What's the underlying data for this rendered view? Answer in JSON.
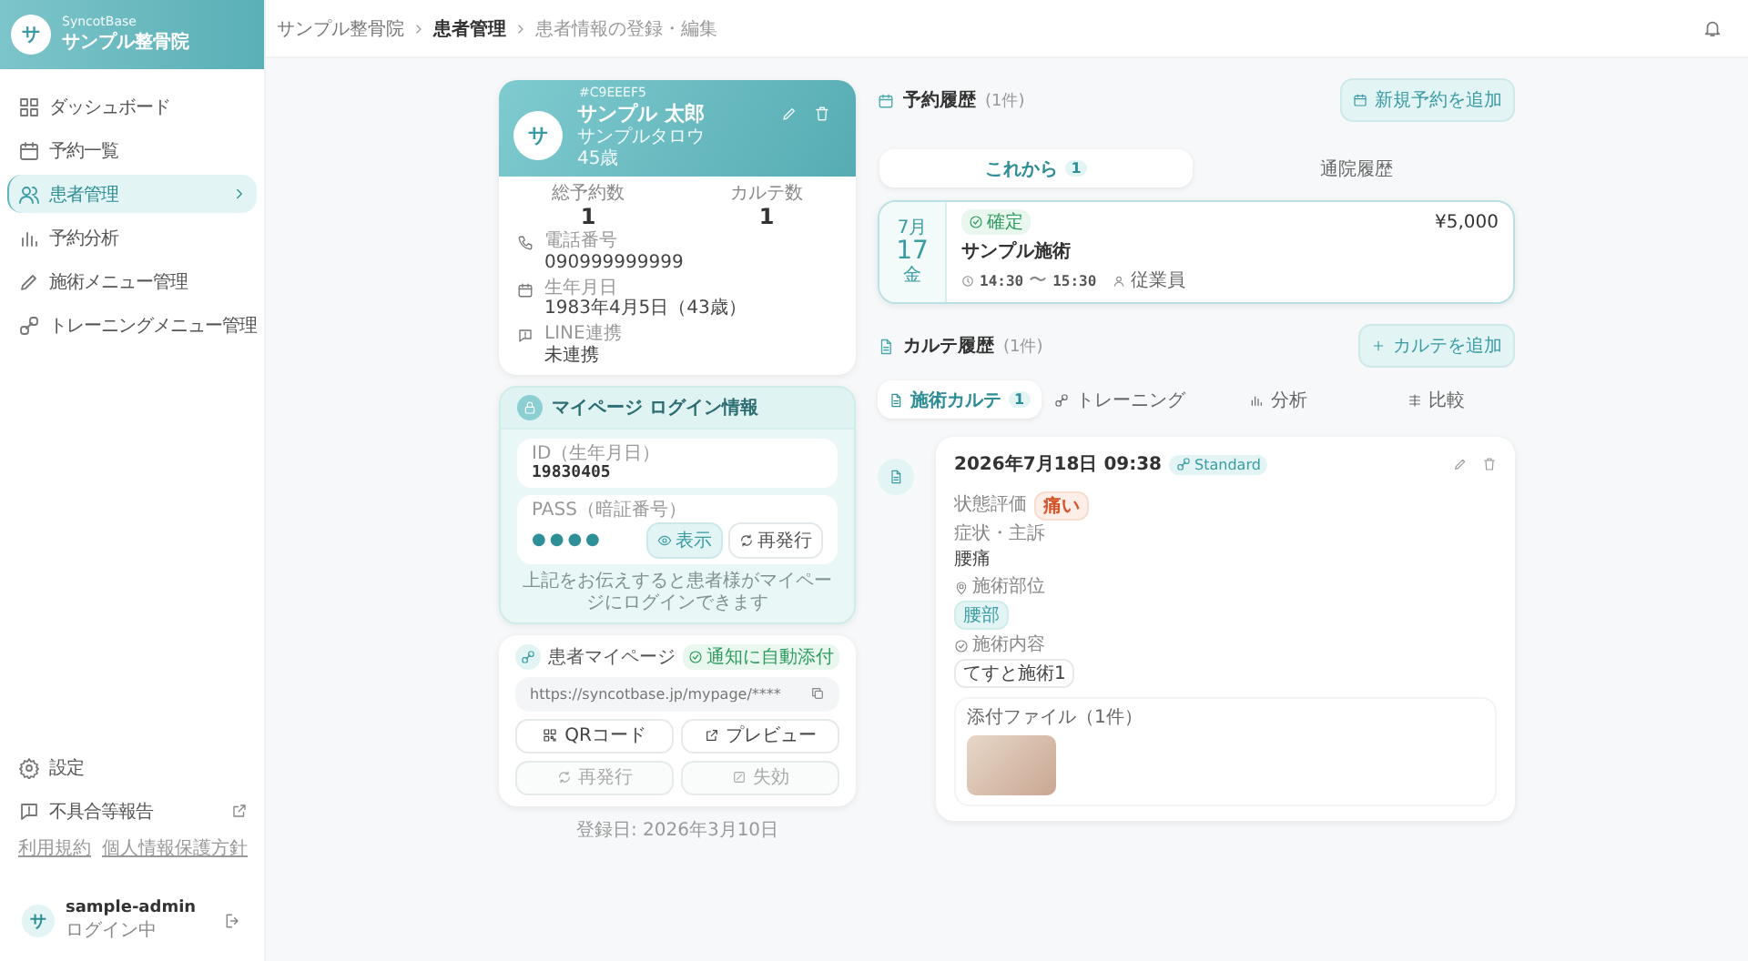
{
  "sidebar": {
    "brand_sub": "SyncotBase",
    "brand": "サンプル整骨院",
    "avatar": "サ",
    "items": [
      {
        "label": "ダッシュボード",
        "selected": false
      },
      {
        "label": "予約一覧",
        "selected": false
      },
      {
        "label": "患者管理",
        "selected": true
      },
      {
        "label": "予約分析",
        "selected": false
      },
      {
        "label": "施術メニュー管理",
        "selected": false
      },
      {
        "label": "トレーニングメニュー管理",
        "selected": false
      }
    ],
    "footer_items": [
      {
        "label": "設定",
        "external": false
      },
      {
        "label": "不具合等報告",
        "external": true
      }
    ],
    "links": [
      "利用規約",
      "個人情報保護方針"
    ],
    "user": {
      "avatar": "サ",
      "name": "sample-admin",
      "status": "ログイン中"
    }
  },
  "breadcrumb": [
    {
      "label": "サンプル整骨院",
      "kind": "link"
    },
    {
      "label": "患者管理",
      "kind": "bold"
    },
    {
      "label": "患者情報の登録・編集",
      "kind": "current"
    }
  ],
  "patient": {
    "code": "#C9EEEF5",
    "avatar": "サ",
    "name": "サンプル 太郎",
    "kana": "サンプルタロウ",
    "age": "45歳",
    "stats": [
      {
        "label": "総予約数",
        "value": "1"
      },
      {
        "label": "カルテ数",
        "value": "1"
      }
    ],
    "fields": [
      {
        "label": "電話番号",
        "value": "090999999999"
      },
      {
        "label": "生年月日",
        "value": "1983年4月5日（43歳）"
      },
      {
        "label": "LINE連携",
        "value": "未連携"
      }
    ]
  },
  "login": {
    "title": "マイページ ログイン情報",
    "id_label": "ID（生年月日）",
    "id": "19830405",
    "pass_label": "PASS（暗証番号）",
    "pass": "●●●●",
    "show_button": "表示",
    "reissue_button": "再発行",
    "note": "上記をお伝えすると患者様がマイページにログインできます"
  },
  "mypage": {
    "title": "患者マイページ",
    "badge": "通知に自動添付",
    "url": "https://syncotbase.jp/mypage/****",
    "buttons": [
      {
        "label": "QRコード",
        "disabled": false
      },
      {
        "label": "プレビュー",
        "disabled": false
      },
      {
        "label": "再発行",
        "disabled": true
      },
      {
        "label": "失効",
        "disabled": true
      }
    ],
    "registered": "登録日: 2026年3月10日"
  },
  "reservations": {
    "title": "予約履歴",
    "count": "(1件)",
    "add_button": "新規予約を追加",
    "tabs": [
      {
        "label": "これから",
        "badge": "1",
        "selected": true
      },
      {
        "label": "通院履歴",
        "selected": false
      }
    ],
    "items": [
      {
        "month": "7月",
        "day": "17",
        "weekday": "金",
        "status": "確定",
        "name": "サンプル施術",
        "start": "14:30",
        "sep": "〜",
        "end": "15:30",
        "staff": "従業員",
        "price": "¥5,000"
      }
    ]
  },
  "records": {
    "title": "カルテ履歴",
    "count": "(1件)",
    "add_button": "カルテを追加",
    "tabs": [
      {
        "label": "施術カルテ",
        "badge": "1",
        "selected": true
      },
      {
        "label": "トレーニング",
        "selected": false
      },
      {
        "label": "分析",
        "selected": false
      },
      {
        "label": "比較",
        "selected": false
      }
    ],
    "items": [
      {
        "date": "2026年7月18日 09:38",
        "plan": "Standard",
        "rating_label": "状態評価",
        "rating": "痛い",
        "complaint_label": "症状・主訴",
        "complaint": "腰痛",
        "area_label": "施術部位",
        "areas": [
          "腰部"
        ],
        "content_label": "施術内容",
        "contents": [
          "てすと施術1"
        ],
        "attachments_label": "添付ファイル（1件）"
      }
    ]
  }
}
